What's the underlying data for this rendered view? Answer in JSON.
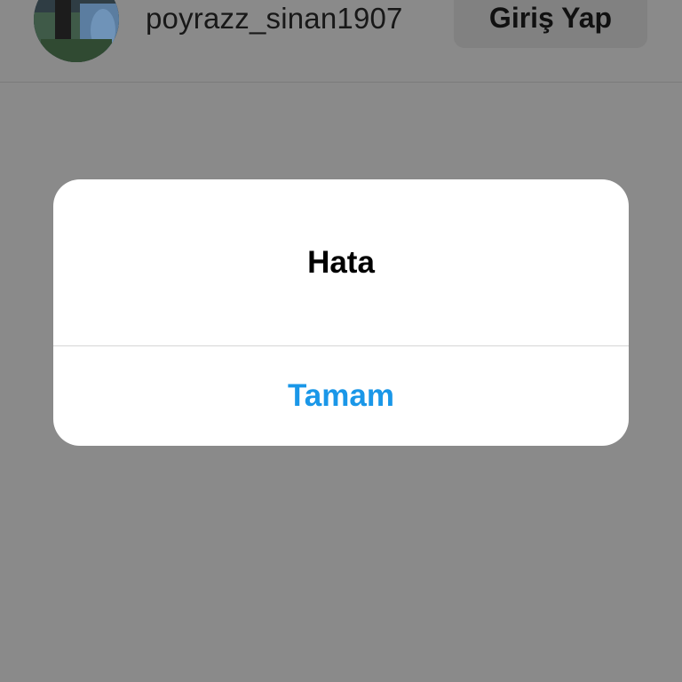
{
  "account": {
    "username": "poyrazz_sinan1907",
    "login_label": "Giriş Yap",
    "avatar_icon": "profile-photo"
  },
  "alert": {
    "title": "Hata",
    "ok_label": "Tamam"
  },
  "colors": {
    "overlay_background": "#8a8a8a",
    "alert_background": "#ffffff",
    "action_blue": "#1a97e8",
    "divider": "#d6d6d6"
  }
}
